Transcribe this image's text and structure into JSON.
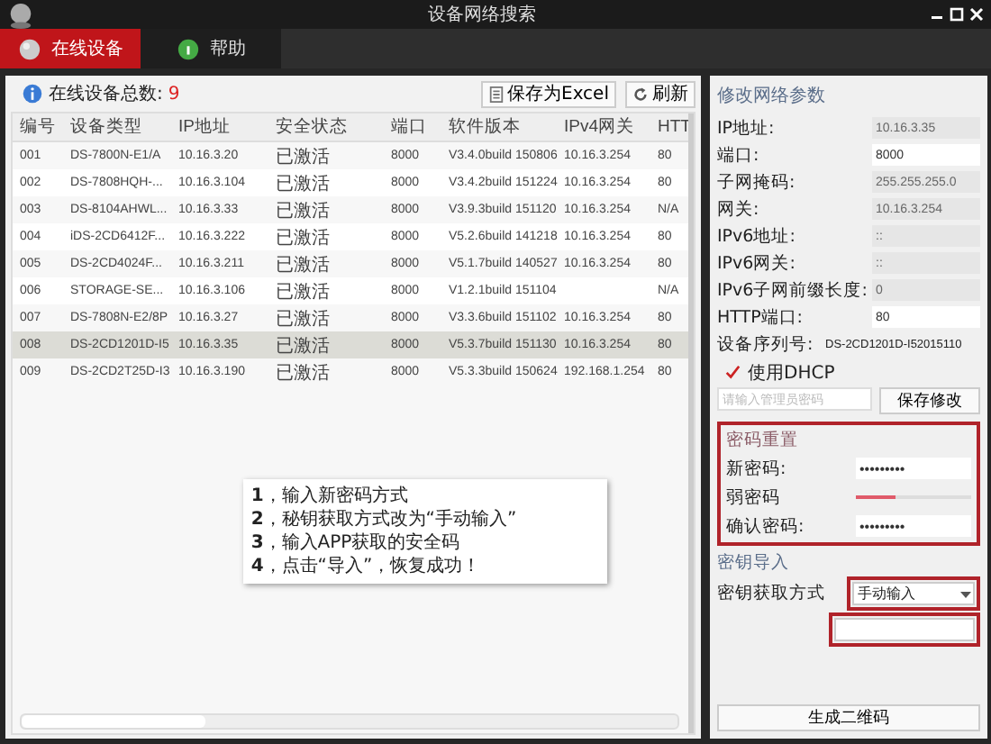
{
  "window": {
    "title": "设备网络搜索"
  },
  "tabs": [
    {
      "label": "在线设备",
      "selected": true
    },
    {
      "label": "帮助",
      "selected": false
    }
  ],
  "device_count": {
    "label": "在线设备总数:",
    "value": "9"
  },
  "toolbar": [
    {
      "label": "保存为Excel"
    },
    {
      "label": "刷新"
    }
  ],
  "table": {
    "columns": [
      "编号",
      "设备类型",
      "IP地址",
      "安全状态",
      "端口",
      "软件版本",
      "IPv4网关",
      "HTT"
    ],
    "rows": [
      {
        "cells": [
          "001",
          "DS-7800N-E1/A",
          "10.16.3.20",
          "已激活",
          "8000",
          "V3.4.0build 150806",
          "10.16.3.254",
          "80"
        ],
        "selected": false
      },
      {
        "cells": [
          "002",
          "DS-7808HQH-...",
          "10.16.3.104",
          "已激活",
          "8000",
          "V3.4.2build 151224",
          "10.16.3.254",
          "80"
        ],
        "selected": false
      },
      {
        "cells": [
          "003",
          "DS-8104AHWL...",
          "10.16.3.33",
          "已激活",
          "8000",
          "V3.9.3build 151120",
          "10.16.3.254",
          "N/A"
        ],
        "selected": false
      },
      {
        "cells": [
          "004",
          "iDS-2CD6412F...",
          "10.16.3.222",
          "已激活",
          "8000",
          "V5.2.6build 141218",
          "10.16.3.254",
          "80"
        ],
        "selected": false
      },
      {
        "cells": [
          "005",
          "DS-2CD4024F...",
          "10.16.3.211",
          "已激活",
          "8000",
          "V5.1.7build 140527",
          "10.16.3.254",
          "80"
        ],
        "selected": false
      },
      {
        "cells": [
          "006",
          "STORAGE-SE...",
          "10.16.3.106",
          "已激活",
          "8000",
          "V1.2.1build 151104",
          "",
          "N/A"
        ],
        "selected": false
      },
      {
        "cells": [
          "007",
          "DS-7808N-E2/8P",
          "10.16.3.27",
          "已激活",
          "8000",
          "V3.3.6build 151102",
          "10.16.3.254",
          "80"
        ],
        "selected": false
      },
      {
        "cells": [
          "008",
          "DS-2CD1201D-I5",
          "10.16.3.35",
          "已激活",
          "8000",
          "V5.3.7build 151130",
          "10.16.3.254",
          "80"
        ],
        "selected": true
      },
      {
        "cells": [
          "009",
          "DS-2CD2T25D-I3",
          "10.16.3.190",
          "已激活",
          "8000",
          "V5.3.3build 150624",
          "192.168.1.254",
          "80"
        ],
        "selected": false
      }
    ]
  },
  "note": {
    "lines": [
      "**1**，输入新密码方式",
      "**2**，秘钥获取方式改为“手动输入”",
      "**3**，输入APP获取的安全码",
      "**4**，点击“导入”，恢复成功！"
    ]
  },
  "panel": {
    "title": "修改网络参数",
    "fields": [
      {
        "label": "IP地址:",
        "value": "10.16.3.35",
        "kind": "readonly"
      },
      {
        "label": "端口:",
        "value": "8000",
        "kind": "editable"
      },
      {
        "label": "子网掩码:",
        "value": "255.255.255.0",
        "kind": "readonly"
      },
      {
        "label": "网关:",
        "value": "10.16.3.254",
        "kind": "readonly"
      },
      {
        "label": "IPv6地址:",
        "value": "::",
        "kind": "readonly"
      },
      {
        "label": "IPv6网关:",
        "value": "::",
        "kind": "readonly"
      },
      {
        "label": "IPv6子网前缀长度:",
        "value": "0",
        "kind": "readonly"
      },
      {
        "label": "HTTP端口:",
        "value": "80",
        "kind": "editable"
      },
      {
        "label": "设备序列号:",
        "value": "DS-2CD1201D-I52015110",
        "kind": "text"
      }
    ],
    "dhcp": {
      "label": "使用DHCP",
      "checked": true
    },
    "admin_password": {
      "placeholder": "请输入管理员密码"
    },
    "save_button": "保存修改",
    "password_reset": {
      "title": "密码重置",
      "highlighted": true,
      "new_password": {
        "label": "新密码:",
        "value": "•••••••••"
      },
      "strength": {
        "label": "弱密码",
        "level": 0.35
      },
      "confirm": {
        "label": "确认密码:",
        "value": "•••••••••"
      }
    },
    "key_import": {
      "title": "密钥导入",
      "method": {
        "label": "密钥获取方式",
        "value": "手动输入",
        "highlighted": true
      },
      "code_field": {
        "highlighted": true
      }
    },
    "generate_button": "生成二维码"
  }
}
